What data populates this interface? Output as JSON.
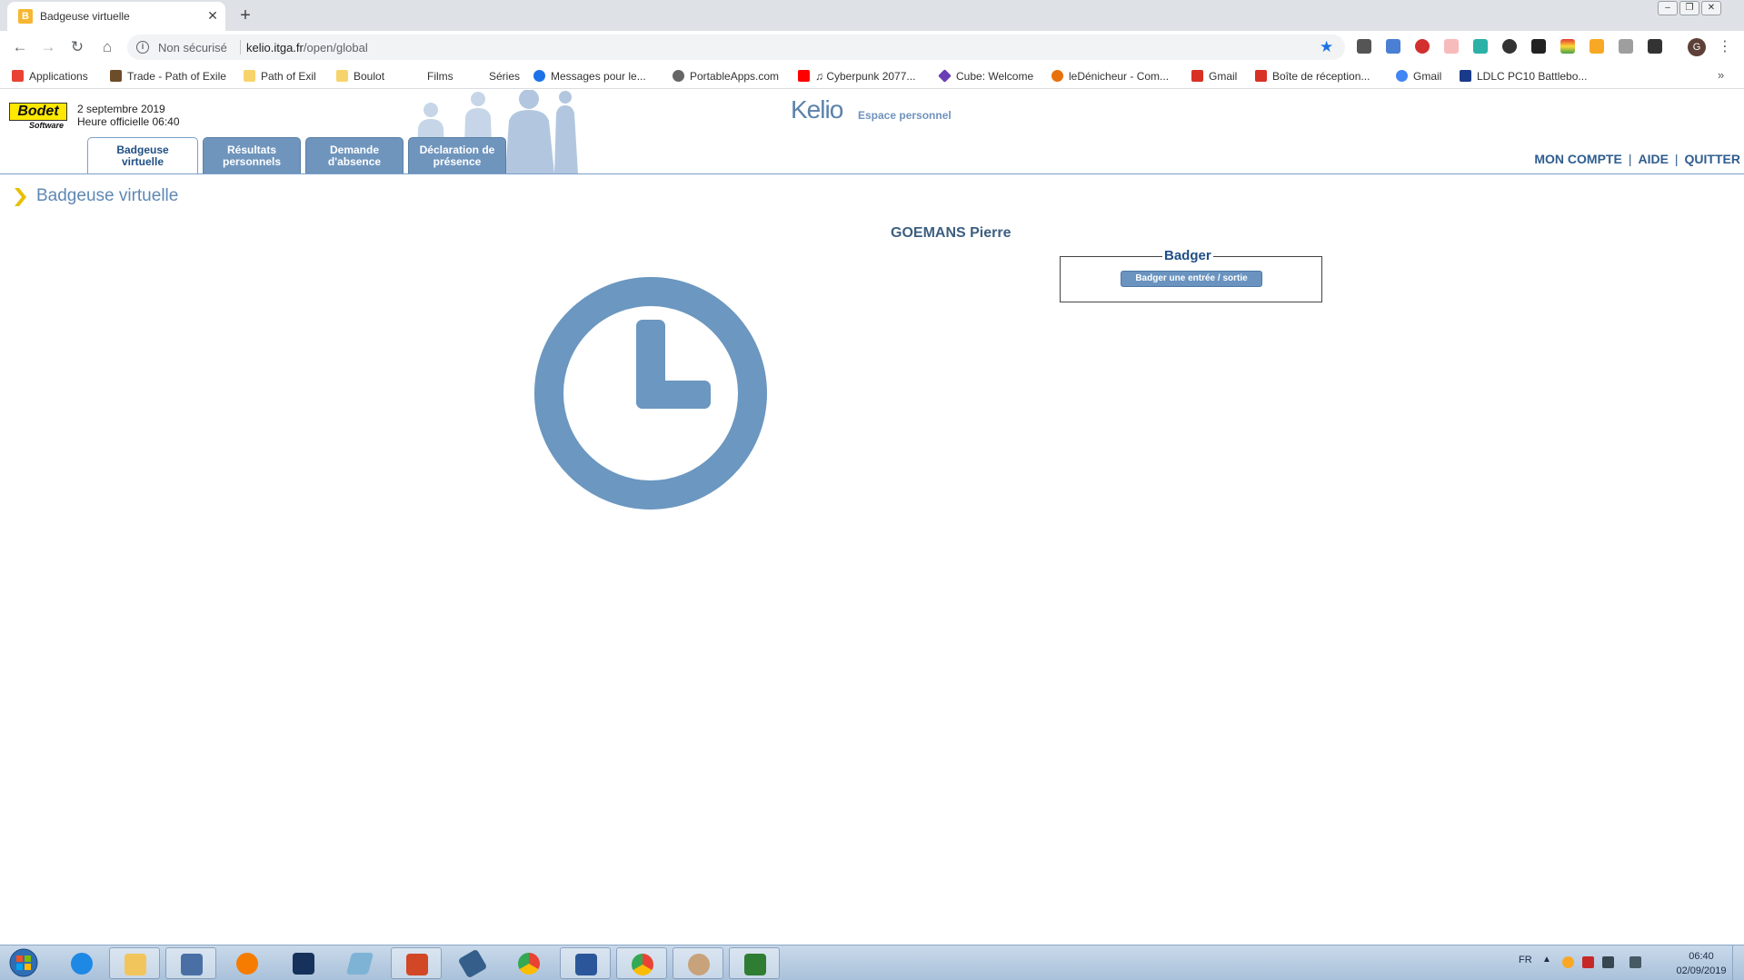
{
  "browser": {
    "tab_title": "Badgeuse virtuelle",
    "tab_favicon_glyph": "B",
    "new_tab_glyph": "+",
    "security_label": "Non sécurisé",
    "url_host": "kelio.itga.fr",
    "url_path": "/open/global",
    "profile_initial": "G",
    "bookmarks": [
      {
        "label": "Applications",
        "icon": "apps-grid-icon",
        "color": "#e94235"
      },
      {
        "label": "Trade - Path of Exile",
        "icon": "poe-trade-icon",
        "color": "#6d4c2a"
      },
      {
        "label": "Path of Exil",
        "icon": "folder-icon",
        "color": "#f7d46b"
      },
      {
        "label": "Boulot",
        "icon": "folder-icon",
        "color": "#f7d46b"
      },
      {
        "label": "Films",
        "icon": "",
        "color": ""
      },
      {
        "label": "Séries",
        "icon": "",
        "color": ""
      },
      {
        "label": "Messages pour le...",
        "icon": "messages-icon",
        "color": "#1a73e8"
      },
      {
        "label": "PortableApps.com",
        "icon": "portableapps-icon",
        "color": "#666666"
      },
      {
        "label": "♫ Cyberpunk 2077...",
        "icon": "youtube-icon",
        "color": "#ff0000"
      },
      {
        "label": "Cube: Welcome",
        "icon": "cube-icon",
        "color": "#6a3fb5"
      },
      {
        "label": "leDénicheur - Com...",
        "icon": "ledenicheur-icon",
        "color": "#e8710a"
      },
      {
        "label": "Gmail",
        "icon": "gmail-icon",
        "color": "#d93025"
      },
      {
        "label": "Boîte de réception...",
        "icon": "gmail-icon",
        "color": "#d93025"
      },
      {
        "label": "Gmail",
        "icon": "google-icon",
        "color": "#4285f4"
      },
      {
        "label": "LDLC PC10 Battlebo...",
        "icon": "ldlc-icon",
        "color": "#1a3a8a"
      }
    ],
    "bookmarks_more_glyph": "»"
  },
  "header": {
    "bodet_logo": "Bodet",
    "bodet_sub": "Software",
    "date": "2 septembre 2019",
    "official_time": "Heure officielle 06:40",
    "kelio_logo": "Kelio",
    "kelio_subtitle": "Espace personnel",
    "tabs": [
      {
        "line1": "Badgeuse",
        "line2": "virtuelle",
        "active": true
      },
      {
        "line1": "Résultats",
        "line2": "personnels",
        "active": false
      },
      {
        "line1": "Demande",
        "line2": "d'absence",
        "active": false
      },
      {
        "line1": "Déclaration de",
        "line2": "présence",
        "active": false
      }
    ],
    "links": {
      "account": "MON COMPTE",
      "help": "AIDE",
      "quit": "QUITTER",
      "separator": "|"
    }
  },
  "main": {
    "page_title": "Badgeuse virtuelle",
    "employee_name": "GOEMANS Pierre",
    "badger": {
      "legend": "Badger",
      "button_label": "Badger une entrée / sortie"
    }
  },
  "colors": {
    "accent": "#6a93bf",
    "clock": "#6b97c0",
    "title": "#5f88b4"
  },
  "taskbar": {
    "language": "FR",
    "time": "06:40",
    "date": "02/09/2019",
    "apps": [
      {
        "name": "internet-explorer",
        "color": "#1e88e5"
      },
      {
        "name": "file-explorer",
        "color": "#f2c55c"
      },
      {
        "name": "remote-keyboard",
        "color": "#4a6fa5"
      },
      {
        "name": "media-player",
        "color": "#f57c00"
      },
      {
        "name": "terminal",
        "color": "#16325c"
      },
      {
        "name": "eraser-tool",
        "color": "#7fb3d5"
      },
      {
        "name": "powerpoint",
        "color": "#d24726"
      },
      {
        "name": "pen-tool",
        "color": "#355f8a"
      },
      {
        "name": "chrome",
        "color": "#34a853"
      },
      {
        "name": "word",
        "color": "#2b579a"
      },
      {
        "name": "chrome-active",
        "color": "#34a853"
      },
      {
        "name": "paint",
        "color": "#c8a27a"
      },
      {
        "name": "spreadsheet-app",
        "color": "#2e7d32"
      }
    ]
  }
}
